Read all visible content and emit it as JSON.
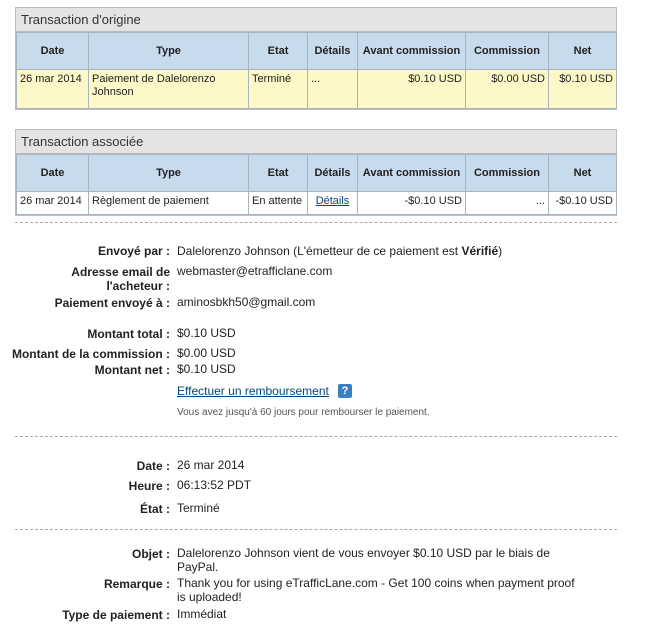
{
  "original": {
    "title": "Transaction d'origine",
    "headers": [
      "Date",
      "Type",
      "Etat",
      "Détails",
      "Avant commission",
      "Commission",
      "Net"
    ],
    "row": {
      "date": "26 mar 2014",
      "type": "Paiement de Dalelorenzo Johnson",
      "etat": "Terminé",
      "details": "...",
      "avant": "$0.10 USD",
      "commission": "$0.00 USD",
      "net": "$0.10 USD"
    }
  },
  "associated": {
    "title": "Transaction associée",
    "headers": [
      "Date",
      "Type",
      "Etat",
      "Détails",
      "Avant commission",
      "Commission",
      "Net"
    ],
    "row": {
      "date": "26 mar 2014",
      "type": "Règlement de paiement",
      "etat": "En attente",
      "details": "Détails",
      "avant": "-$0.10 USD",
      "commission": "...",
      "net": "-$0.10 USD"
    }
  },
  "details": {
    "sent_by_label": "Envoyé par :",
    "sent_by_value": "Dalelorenzo Johnson (L'émetteur de ce paiement est ",
    "sent_by_status": "Vérifié",
    "sent_by_close": ")",
    "buyer_email_label": "Adresse email de l'acheteur :",
    "buyer_email_value": "webmaster@etrafficlane.com",
    "sent_to_label": "Paiement envoyé à :",
    "sent_to_value": "aminosbkh50@gmail.com",
    "total_label": "Montant total :",
    "total_value": "$0.10 USD",
    "commission_label": "Montant de la commission :",
    "commission_value": "$0.00 USD",
    "net_label": "Montant net :",
    "net_value": "$0.10 USD",
    "refund_link": "Effectuer un remboursement",
    "refund_note": "Vous avez jusqu'à 60 jours pour rembourser le paiement.",
    "date_label": "Date :",
    "date_value": "26 mar 2014",
    "time_label": "Heure :",
    "time_value": "06:13:52 PDT",
    "state_label": "État :",
    "state_value": "Terminé",
    "subject_label": "Objet :",
    "subject_value_1": "Dalelorenzo Johnson vient de vous envoyer $0.10 USD par le biais de",
    "subject_value_2": "PayPal.",
    "note_label": "Remarque :",
    "note_value_1": "Thank you for using eTrafficLane.com - Get 100 coins when payment proof",
    "note_value_2": "is uploaded!",
    "payment_type_label": "Type de paiement :",
    "payment_type_value": "Immédiat"
  }
}
